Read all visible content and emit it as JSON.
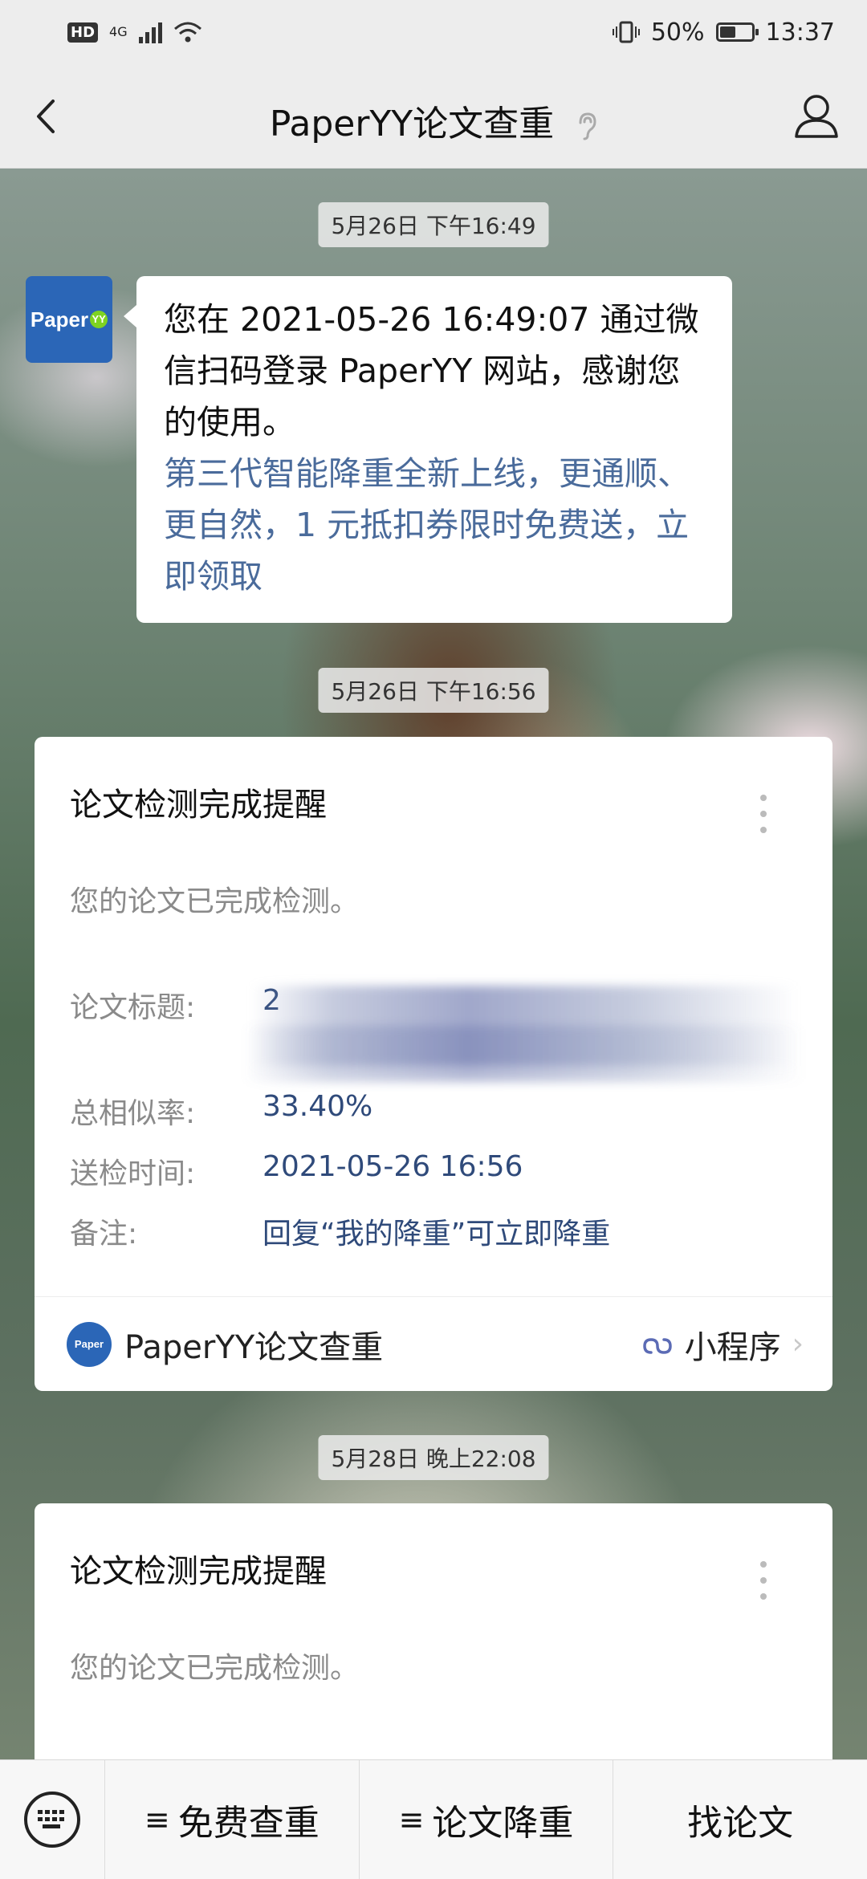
{
  "status_bar": {
    "network": "HD",
    "signal_type": "4G",
    "battery": "50%",
    "battery_level": 0.5,
    "time": "13:37"
  },
  "header": {
    "title": "PaperYY论文查重"
  },
  "messages": {
    "ts1": "5月26日 下午16:49",
    "bubble_text": "您在 2021-05-26 16:49:07 通过微信扫码登录 PaperYY 网站，感谢您的使用。",
    "bubble_link": "第三代智能降重全新上线，更通顺、更自然，1 元抵扣券限时免费送，立即领取",
    "avatar_label": "Paper",
    "ts2": "5月26日 下午16:56",
    "ts3": "5月28日 晚上22:08"
  },
  "card1": {
    "title": "论文检测完成提醒",
    "intro": "您的论文已完成检测。",
    "paper_title_key": "论文标题:",
    "paper_title_value": "2",
    "similarity_key": "总相似率:",
    "similarity_value": "33.40%",
    "time_key": "送检时间:",
    "time_value": "2021-05-26 16:56",
    "note_key": "备注:",
    "note_value": "回复“我的降重”可立即降重",
    "footer_name": "PaperYY论文查重",
    "footer_type": "小程序"
  },
  "card2": {
    "title": "论文检测完成提醒",
    "intro": "您的论文已完成检测。"
  },
  "menu": {
    "item1": "免费查重",
    "item2": "论文降重",
    "item3": "找论文"
  }
}
